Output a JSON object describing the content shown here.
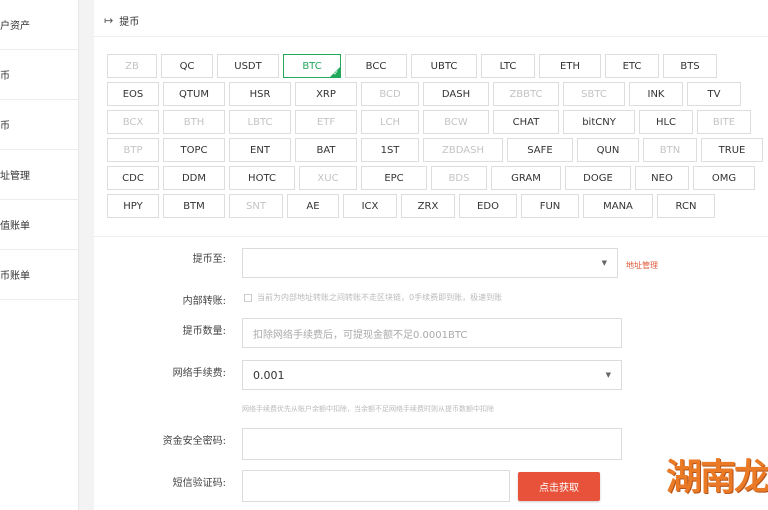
{
  "sidebar": {
    "items": [
      {
        "label": "户资产"
      },
      {
        "label": "币"
      },
      {
        "label": "币"
      },
      {
        "label": "址管理"
      },
      {
        "label": "值账单"
      },
      {
        "label": "币账单"
      }
    ]
  },
  "header": {
    "title": "提币"
  },
  "coins": [
    [
      {
        "label": "ZB",
        "disabled": true,
        "w": 50
      },
      {
        "label": "QC",
        "disabled": false,
        "w": 52
      },
      {
        "label": "USDT",
        "disabled": false,
        "w": 62
      },
      {
        "label": "BTC",
        "disabled": false,
        "selected": true,
        "w": 58
      },
      {
        "label": "BCC",
        "disabled": false,
        "w": 62
      },
      {
        "label": "UBTC",
        "disabled": false,
        "w": 66
      },
      {
        "label": "LTC",
        "disabled": false,
        "w": 54
      },
      {
        "label": "ETH",
        "disabled": false,
        "w": 62
      },
      {
        "label": "ETC",
        "disabled": false,
        "w": 54
      },
      {
        "label": "BTS",
        "disabled": false,
        "w": 54
      }
    ],
    [
      {
        "label": "EOS",
        "disabled": false,
        "w": 52
      },
      {
        "label": "QTUM",
        "disabled": false,
        "w": 62
      },
      {
        "label": "HSR",
        "disabled": false,
        "w": 62
      },
      {
        "label": "XRP",
        "disabled": false,
        "w": 62
      },
      {
        "label": "BCD",
        "disabled": true,
        "w": 58
      },
      {
        "label": "DASH",
        "disabled": false,
        "w": 66
      },
      {
        "label": "ZBBTC",
        "disabled": true,
        "w": 66
      },
      {
        "label": "SBTC",
        "disabled": true,
        "w": 62
      },
      {
        "label": "INK",
        "disabled": false,
        "w": 54
      },
      {
        "label": "TV",
        "disabled": false,
        "w": 54
      }
    ],
    [
      {
        "label": "BCX",
        "disabled": true,
        "w": 52
      },
      {
        "label": "BTH",
        "disabled": true,
        "w": 62
      },
      {
        "label": "LBTC",
        "disabled": true,
        "w": 62
      },
      {
        "label": "ETF",
        "disabled": true,
        "w": 62
      },
      {
        "label": "LCH",
        "disabled": true,
        "w": 58
      },
      {
        "label": "BCW",
        "disabled": true,
        "w": 66
      },
      {
        "label": "CHAT",
        "disabled": false,
        "w": 66
      },
      {
        "label": "bitCNY",
        "disabled": false,
        "w": 72
      },
      {
        "label": "HLC",
        "disabled": false,
        "w": 54
      },
      {
        "label": "BITE",
        "disabled": true,
        "w": 54
      }
    ],
    [
      {
        "label": "BTP",
        "disabled": true,
        "w": 52
      },
      {
        "label": "TOPC",
        "disabled": false,
        "w": 62
      },
      {
        "label": "ENT",
        "disabled": false,
        "w": 62
      },
      {
        "label": "BAT",
        "disabled": false,
        "w": 62
      },
      {
        "label": "1ST",
        "disabled": false,
        "w": 58
      },
      {
        "label": "ZBDASH",
        "disabled": true,
        "w": 80
      },
      {
        "label": "SAFE",
        "disabled": false,
        "w": 66
      },
      {
        "label": "QUN",
        "disabled": false,
        "w": 62
      },
      {
        "label": "BTN",
        "disabled": true,
        "w": 54
      },
      {
        "label": "TRUE",
        "disabled": false,
        "w": 62
      }
    ],
    [
      {
        "label": "CDC",
        "disabled": false,
        "w": 52
      },
      {
        "label": "DDM",
        "disabled": false,
        "w": 62
      },
      {
        "label": "HOTC",
        "disabled": false,
        "w": 66
      },
      {
        "label": "XUC",
        "disabled": true,
        "w": 58
      },
      {
        "label": "EPC",
        "disabled": false,
        "w": 66
      },
      {
        "label": "BDS",
        "disabled": true,
        "w": 56
      },
      {
        "label": "GRAM",
        "disabled": false,
        "w": 70
      },
      {
        "label": "DOGE",
        "disabled": false,
        "w": 66
      },
      {
        "label": "NEO",
        "disabled": false,
        "w": 54
      },
      {
        "label": "OMG",
        "disabled": false,
        "w": 62
      }
    ],
    [
      {
        "label": "HPY",
        "disabled": false,
        "w": 52
      },
      {
        "label": "BTM",
        "disabled": false,
        "w": 62
      },
      {
        "label": "SNT",
        "disabled": true,
        "w": 54
      },
      {
        "label": "AE",
        "disabled": false,
        "w": 52
      },
      {
        "label": "ICX",
        "disabled": false,
        "w": 54
      },
      {
        "label": "ZRX",
        "disabled": false,
        "w": 54
      },
      {
        "label": "EDO",
        "disabled": false,
        "w": 58
      },
      {
        "label": "FUN",
        "disabled": false,
        "w": 58
      },
      {
        "label": "MANA",
        "disabled": false,
        "w": 70
      },
      {
        "label": "RCN",
        "disabled": false,
        "w": 58
      }
    ]
  ],
  "form": {
    "address_label": "提币至:",
    "address_manage_link": "地址管理",
    "internal_label": "内部转账:",
    "internal_text": "当前为内部地址转账之间转账不走区块链，0手续费即到账，极速到账",
    "amount_label": "提币数量:",
    "amount_placeholder": "扣除网络手续费后，可提现金额不足0.0001BTC",
    "fee_label": "网络手续费:",
    "fee_value": "0.001",
    "fee_hint": "网络手续费优先从账户余额中扣除，当余额不足网络手续费时则从提币数额中扣除",
    "password_label": "资金安全密码:",
    "sms_label": "短信验证码:",
    "sms_button": "点击获取"
  },
  "watermark": {
    "text": "湖南龙"
  },
  "colors": {
    "accent": "#22a85a",
    "button": "#e8523a",
    "watermark": "#ea7a25"
  }
}
